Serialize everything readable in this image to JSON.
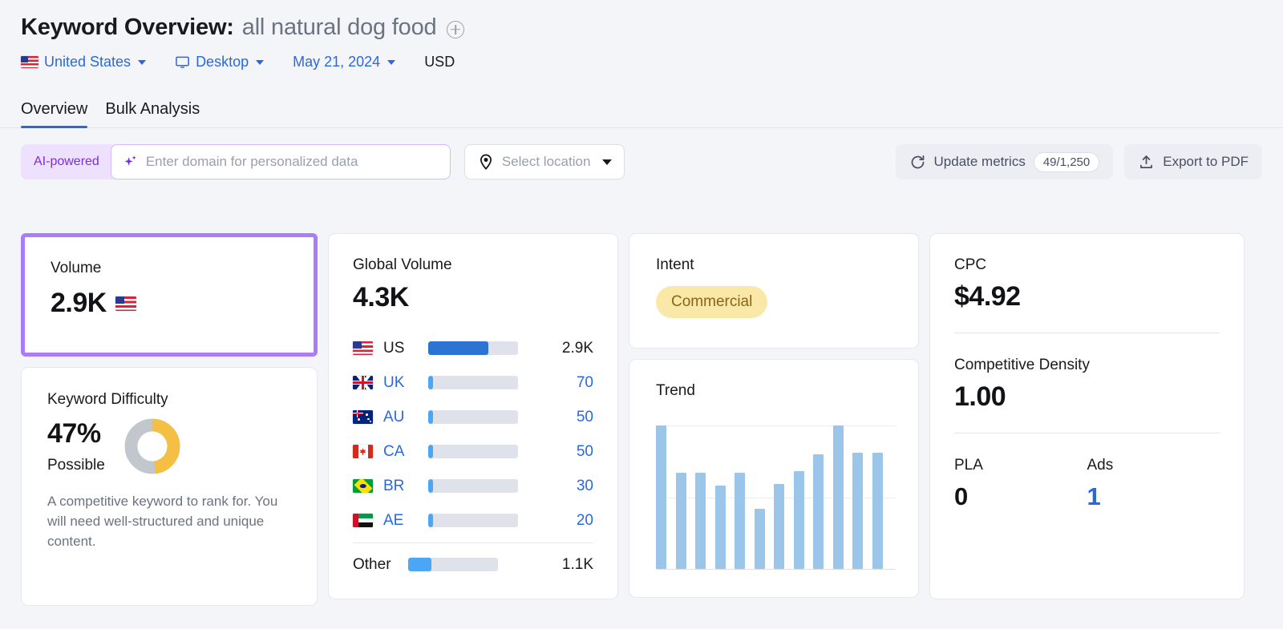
{
  "header": {
    "title_label": "Keyword Overview:",
    "keyword": "all natural dog food",
    "add_icon": "plus-circle-icon",
    "country": "United States",
    "device": "Desktop",
    "date": "May 21, 2024",
    "currency": "USD"
  },
  "tabs": [
    {
      "label": "Overview",
      "active": true
    },
    {
      "label": "Bulk Analysis",
      "active": false
    }
  ],
  "controls": {
    "ai_badge": "AI-powered",
    "domain_placeholder": "Enter domain for personalized data",
    "domain_value": "",
    "location_placeholder": "Select location",
    "update_metrics_label": "Update metrics",
    "update_metrics_count": "49/1,250",
    "export_label": "Export to PDF"
  },
  "cards": {
    "volume": {
      "label": "Volume",
      "value": "2.9K",
      "flag": "us",
      "highlight_color": "#a97cf8"
    },
    "keyword_difficulty": {
      "label": "Keyword Difficulty",
      "percent": "47%",
      "status": "Possible",
      "description": "A competitive keyword to rank for. You will need well-structured and unique content.",
      "donut_value": 47,
      "donut_color": "#f5bf43",
      "donut_track_color": "#c2c6cd"
    },
    "global_volume": {
      "label": "Global Volume",
      "value": "4.3K",
      "rows": [
        {
          "flag": "us",
          "code": "US",
          "value": "2.9K",
          "pct": 67,
          "bar_color": "#2d73d2",
          "primary": true
        },
        {
          "flag": "uk",
          "code": "UK",
          "value": "70",
          "pct": 5,
          "bar_color": "#4ba6f5",
          "primary": false
        },
        {
          "flag": "au",
          "code": "AU",
          "value": "50",
          "pct": 5,
          "bar_color": "#4ba6f5",
          "primary": false
        },
        {
          "flag": "ca",
          "code": "CA",
          "value": "50",
          "pct": 5,
          "bar_color": "#4ba6f5",
          "primary": false
        },
        {
          "flag": "br",
          "code": "BR",
          "value": "30",
          "pct": 5,
          "bar_color": "#4ba6f5",
          "primary": false
        },
        {
          "flag": "ae",
          "code": "AE",
          "value": "20",
          "pct": 5,
          "bar_color": "#4ba6f5",
          "primary": false
        }
      ],
      "other": {
        "label": "Other",
        "value": "1.1K",
        "pct": 26,
        "bar_color": "#4ba6f5"
      }
    },
    "intent": {
      "label": "Intent",
      "value": "Commercial",
      "pill_bg": "#fae8a8",
      "pill_fg": "#8a6318"
    },
    "trend": {
      "label": "Trend"
    },
    "cpc": {
      "label": "CPC",
      "value": "$4.92"
    },
    "competitive_density": {
      "label": "Competitive Density",
      "value": "1.00"
    },
    "pla": {
      "label": "PLA",
      "value": "0"
    },
    "ads": {
      "label": "Ads",
      "value": "1"
    }
  },
  "chart_data": {
    "type": "bar",
    "title": "Trend",
    "xlabel": "",
    "ylabel": "",
    "categories": [
      "1",
      "2",
      "3",
      "4",
      "5",
      "6",
      "7",
      "8",
      "9",
      "10",
      "11",
      "12"
    ],
    "values": [
      100,
      67,
      67,
      58,
      67,
      42,
      59,
      68,
      80,
      100,
      81,
      81
    ],
    "ylim": [
      0,
      100
    ],
    "grid": true,
    "legend": "none",
    "bar_color": "#9cc5ea"
  }
}
